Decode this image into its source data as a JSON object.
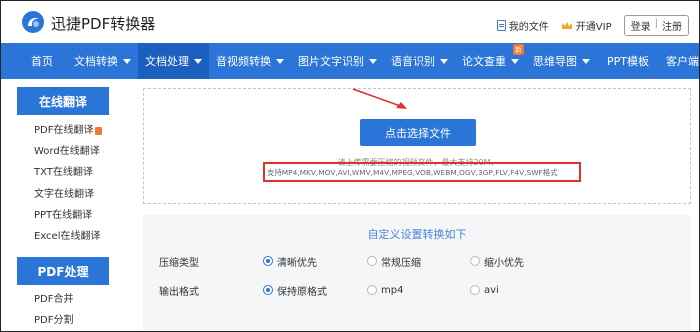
{
  "header": {
    "brand": "迅捷PDF转换器",
    "my_files": "我的文件",
    "vip": "开通VIP",
    "login": "登录",
    "separator": "|",
    "register": "注册"
  },
  "nav": {
    "items": [
      {
        "label": "首页",
        "dropdown": false
      },
      {
        "label": "文档转换",
        "dropdown": true
      },
      {
        "label": "文档处理",
        "dropdown": true,
        "active": true
      },
      {
        "label": "音视频转换",
        "dropdown": true
      },
      {
        "label": "图片文字识别",
        "dropdown": true
      },
      {
        "label": "语音识别",
        "dropdown": true
      },
      {
        "label": "论文查重",
        "dropdown": true,
        "badge": "新"
      },
      {
        "label": "思维导图",
        "dropdown": true
      },
      {
        "label": "PPT模板",
        "dropdown": false
      },
      {
        "label": "客户端",
        "dropdown": true
      }
    ]
  },
  "sidebar": {
    "section1_title": "在线翻译",
    "section1_items": [
      "PDF在线翻译",
      "Word在线翻译",
      "TXT在线翻译",
      "文字在线翻译",
      "PPT在线翻译",
      "Excel在线翻译"
    ],
    "section2_title": "PDF处理",
    "section2_items": [
      "PDF合并",
      "PDF分割"
    ]
  },
  "upload": {
    "button": "点击选择文件",
    "hint": "请上传需要压缩的视频文件，最大支持20M，",
    "formats": "支持MP4,MKV,MOV,AVI,WMV,M4V,MPEG,VOB,WEBM,OGV,3GP,FLV,F4V,SWF格式"
  },
  "settings": {
    "title": "自定义设置转换如下",
    "compress_label": "压缩类型",
    "compress_options": [
      "清晰优先",
      "常规压缩",
      "缩小优先"
    ],
    "compress_selected": 0,
    "format_label": "输出格式",
    "format_options": [
      "保持原格式",
      "mp4",
      "avi"
    ],
    "format_selected": 0
  },
  "colors": {
    "primary": "#2b75d8",
    "nav_active": "#1b5fbf",
    "highlight_box": "#e03030",
    "badge": "#f07a30"
  }
}
